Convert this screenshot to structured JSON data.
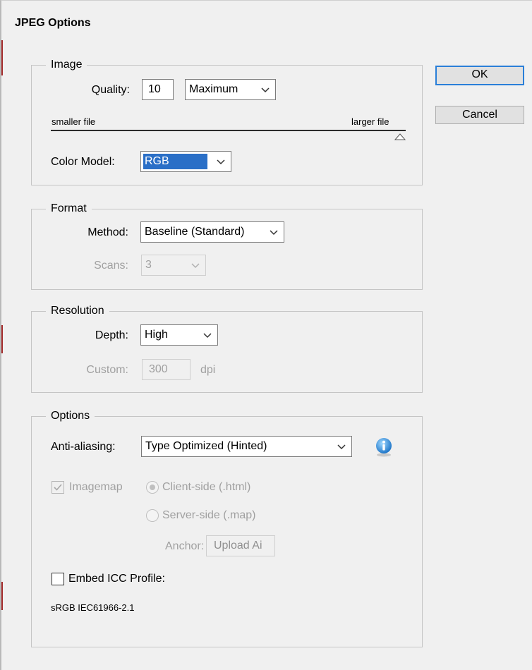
{
  "dialog": {
    "title": "JPEG Options",
    "ok_label": "OK",
    "cancel_label": "Cancel"
  },
  "image": {
    "legend": "Image",
    "quality_label": "Quality:",
    "quality_value": "10",
    "quality_preset": "Maximum",
    "slider_min_label": "smaller file",
    "slider_max_label": "larger file",
    "slider_level": 1.0,
    "color_model_label": "Color Model:",
    "color_model_value": "RGB"
  },
  "format": {
    "legend": "Format",
    "method_label": "Method:",
    "method_value": "Baseline (Standard)",
    "scans_label": "Scans:",
    "scans_value": "3"
  },
  "resolution": {
    "legend": "Resolution",
    "depth_label": "Depth:",
    "depth_value": "High",
    "custom_label": "Custom:",
    "custom_value": "300",
    "custom_unit": "dpi"
  },
  "options": {
    "legend": "Options",
    "antialiasing_label": "Anti-aliasing:",
    "antialiasing_value": "Type Optimized (Hinted)",
    "imagemap_label": "Imagemap",
    "imagemap_checked": true,
    "client_side_label": "Client-side (.html)",
    "server_side_label": "Server-side (.map)",
    "anchor_label": "Anchor:",
    "anchor_value": "Upload Ai",
    "embed_icc_label": "Embed ICC Profile:",
    "embed_icc_checked": false,
    "icc_profile_name": "sRGB IEC61966-2.1"
  },
  "colors": {
    "accent_blue": "#2a7fd8",
    "selection_blue": "#2a6fc7",
    "info_icon_blue": "#1f77c9"
  }
}
